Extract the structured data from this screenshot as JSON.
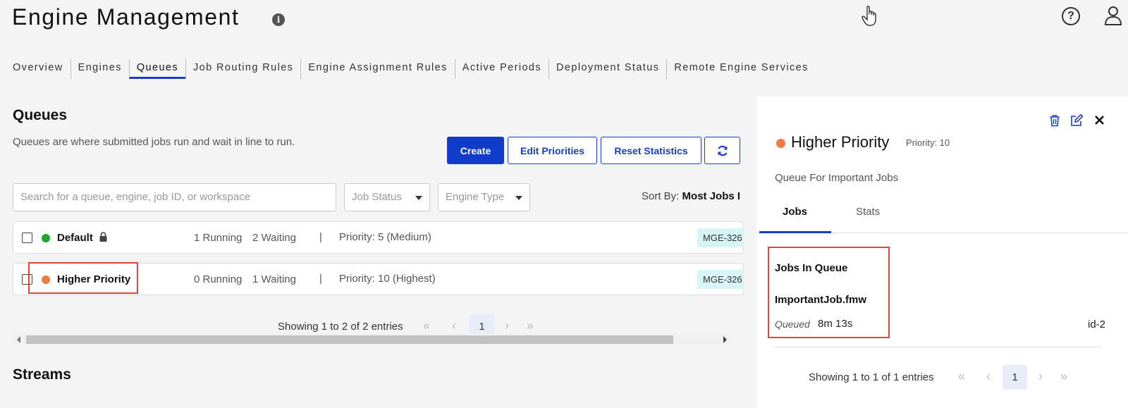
{
  "header": {
    "title": "Engine Management",
    "info_icon": "i",
    "help_icon": "?"
  },
  "nav": {
    "tabs": [
      {
        "label": "Overview"
      },
      {
        "label": "Engines"
      },
      {
        "label": "Queues",
        "active": true
      },
      {
        "label": "Job Routing Rules"
      },
      {
        "label": "Engine Assignment Rules"
      },
      {
        "label": "Active Periods"
      },
      {
        "label": "Deployment Status"
      },
      {
        "label": "Remote Engine Services"
      }
    ]
  },
  "queues": {
    "title": "Queues",
    "description": "Queues are where submitted jobs run and wait in line to run.",
    "buttons": {
      "create": "Create",
      "edit_priorities": "Edit Priorities",
      "reset_statistics": "Reset Statistics"
    },
    "search_placeholder": "Search for a queue, engine, job ID, or workspace",
    "filters": {
      "job_status": "Job Status",
      "engine_type": "Engine Type"
    },
    "sort": {
      "label": "Sort By:",
      "value": "Most Jobs I"
    },
    "rows": [
      {
        "name": "Default",
        "status_color": "#1aa830",
        "running": "1 Running",
        "waiting": "2 Waiting",
        "separator": "|",
        "priority": "Priority: 5 (Medium)",
        "engine_tag": "MGE-326"
      },
      {
        "name": "Higher Priority",
        "status_color": "#f07b3f",
        "running": "0 Running",
        "waiting": "1 Waiting",
        "separator": "|",
        "priority": "Priority: 10 (Highest)",
        "engine_tag": "MGE-326"
      }
    ],
    "pagination": {
      "summary": "Showing 1 to 2 of 2 entries",
      "current_page": "1"
    }
  },
  "streams": {
    "title": "Streams"
  },
  "detail_panel": {
    "title": "Higher Priority",
    "status_color": "#f07b3f",
    "priority": "Priority: 10",
    "description": "Queue For Important Jobs",
    "tabs": [
      {
        "label": "Jobs",
        "active": true
      },
      {
        "label": "Stats"
      }
    ],
    "jobs_label": "Jobs In Queue",
    "job": {
      "name": "ImportantJob.fmw",
      "status": "Queued",
      "elapsed": "8m 13s",
      "id": "id-2"
    },
    "pagination": {
      "summary": "Showing 1 to 1 of 1 entries",
      "current_page": "1"
    }
  },
  "colors": {
    "accent": "#1a3cc8",
    "highlight": "#e0443a",
    "tag_bg": "#d7f4f7"
  }
}
